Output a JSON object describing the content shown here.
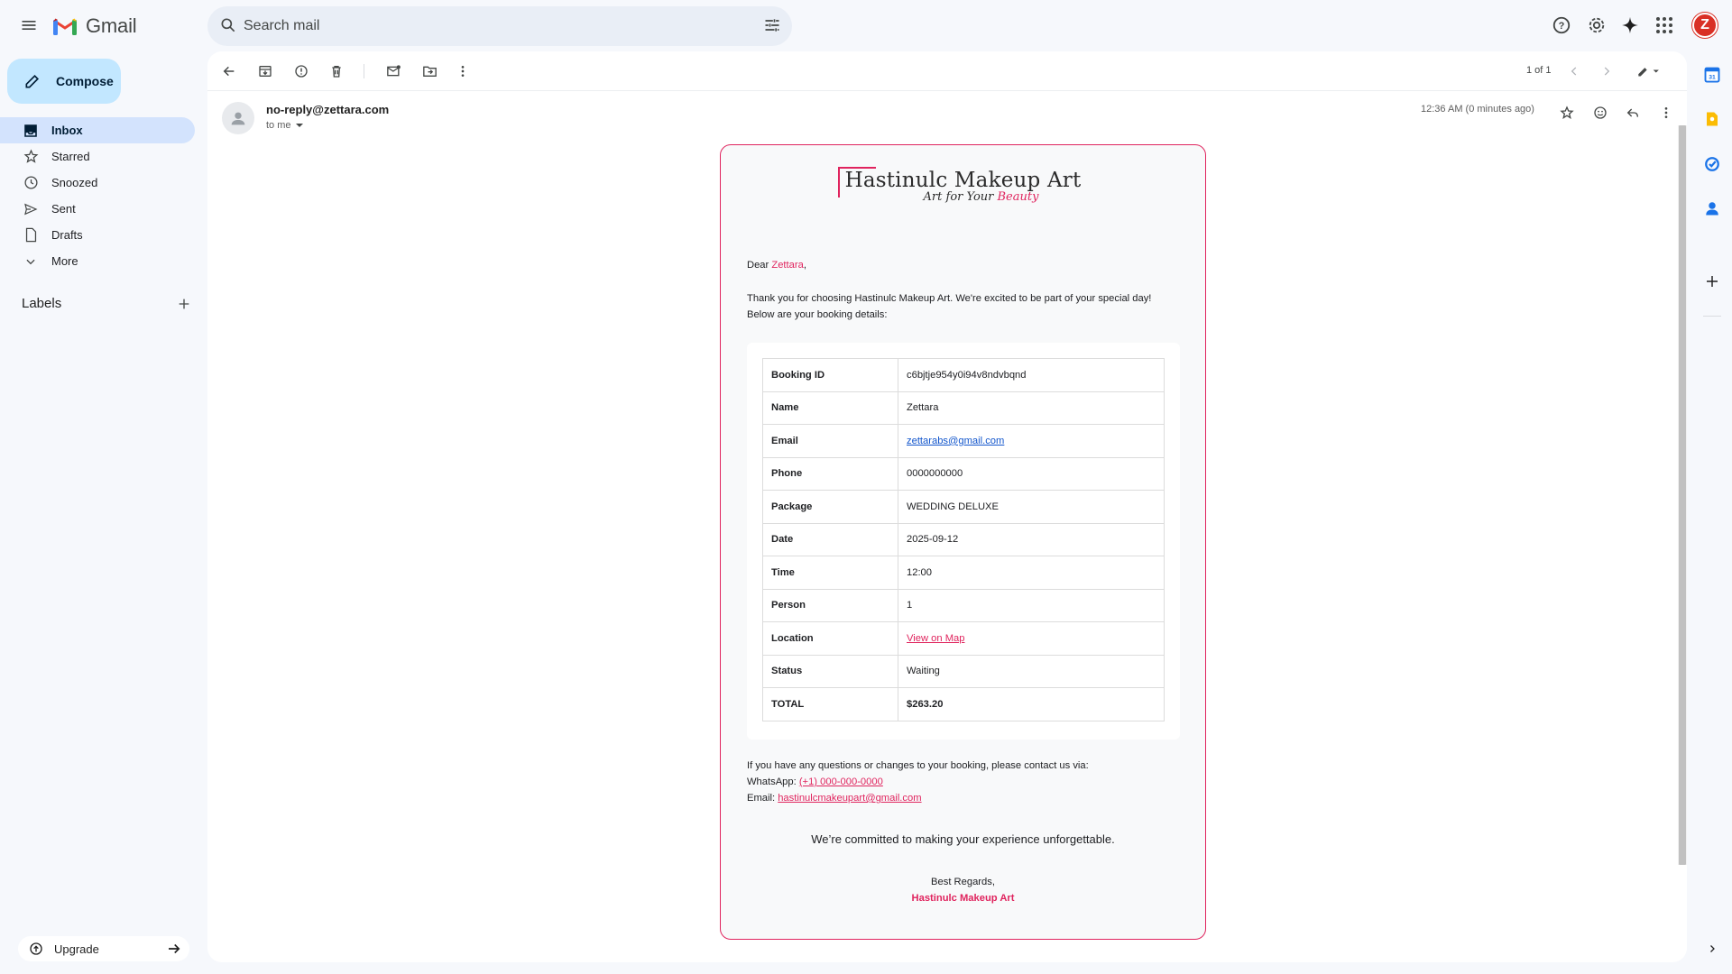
{
  "app": {
    "name": "Gmail"
  },
  "search": {
    "placeholder": "Search mail"
  },
  "compose": {
    "label": "Compose"
  },
  "sidebar": {
    "items": [
      {
        "label": "Inbox",
        "icon": "inbox-icon",
        "active": true
      },
      {
        "label": "Starred",
        "icon": "star-icon"
      },
      {
        "label": "Snoozed",
        "icon": "clock-icon"
      },
      {
        "label": "Sent",
        "icon": "send-icon"
      },
      {
        "label": "Drafts",
        "icon": "draft-icon"
      },
      {
        "label": "More",
        "icon": "chevron-down-icon"
      }
    ],
    "labels_heading": "Labels",
    "upgrade_label": "Upgrade"
  },
  "user": {
    "avatar_letter": "Z",
    "avatar_color": "#d93025"
  },
  "toolbar": {
    "pager": "1 of 1"
  },
  "message": {
    "from": "no-reply@zettara.com",
    "to": "to me",
    "timestamp": "12:36 AM (0 minutes ago)"
  },
  "email": {
    "brand": {
      "name": "Hastinulc Makeup Art",
      "tagline_a": "Art for Your ",
      "tagline_b": "Beauty"
    },
    "greeting_prefix": "Dear ",
    "greeting_name": "Zettara",
    "greeting_suffix": ",",
    "intro_1": "Thank you for choosing Hastinulc Makeup Art. We're excited to be part of your special day!",
    "intro_2": "Below are your booking details:",
    "booking": [
      {
        "key": "Booking ID",
        "value": "c6bjtje954y0i94v8ndvbqnd"
      },
      {
        "key": "Name",
        "value": "Zettara"
      },
      {
        "key": "Email",
        "value": "zettarabs@gmail.com"
      },
      {
        "key": "Phone",
        "value": "0000000000"
      },
      {
        "key": "Package",
        "value": "WEDDING DELUXE"
      },
      {
        "key": "Date",
        "value": "2025-09-12"
      },
      {
        "key": "Time",
        "value": "12:00"
      },
      {
        "key": "Person",
        "value": "1"
      },
      {
        "key": "Location",
        "value": "View on Map"
      },
      {
        "key": "Status",
        "value": "Waiting"
      },
      {
        "key": "TOTAL",
        "value": "$263.20"
      }
    ],
    "contact_intro": "If you have any questions or changes to your booking, please contact us via:",
    "whatsapp_label": "WhatsApp: ",
    "whatsapp_value": "(+1) 000-000-0000",
    "email_label": "Email: ",
    "email_value": "hastinulcmakeupart@gmail.com",
    "commitment": "We’re committed to making your experience unforgettable.",
    "regards": "Best Regards,",
    "signature": "Hastinulc Makeup Art",
    "accent_color": "#e0245e"
  }
}
